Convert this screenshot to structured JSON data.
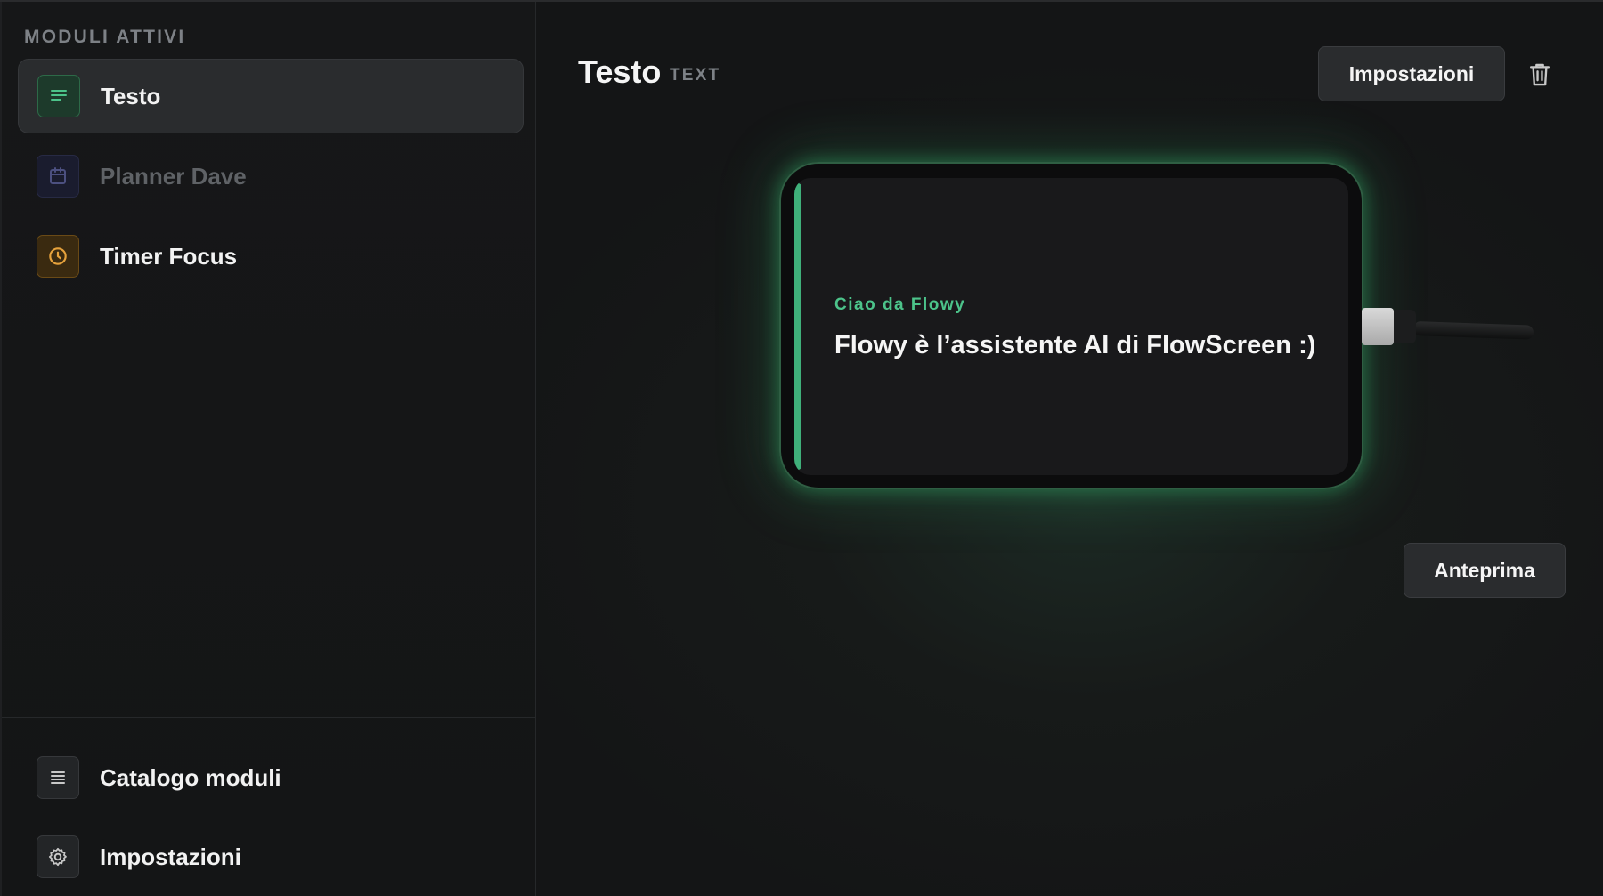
{
  "sidebar": {
    "section_title": "MODULI ATTIVI",
    "modules": [
      {
        "label": "Testo",
        "icon": "text-lines-icon",
        "active": true
      },
      {
        "label": "Planner Dave",
        "icon": "calendar-icon",
        "active": false,
        "dimmed": true
      },
      {
        "label": "Timer Focus",
        "icon": "clock-icon",
        "active": false
      }
    ],
    "footer": [
      {
        "label": "Catalogo moduli",
        "icon": "list-icon"
      },
      {
        "label": "Impostazioni",
        "icon": "gear-icon"
      }
    ]
  },
  "main": {
    "title": "Testo",
    "type_badge": "TEXT",
    "settings_button": "Impostazioni",
    "delete_icon": "trash-icon",
    "preview_button": "Anteprima",
    "device": {
      "kicker": "Ciao da Flowy",
      "message": "Flowy è l’assistente AI di FlowScreen :)"
    }
  },
  "colors": {
    "accent_green": "#3fb07a",
    "amber": "#e6a23c",
    "indigo": "#4c5080",
    "background": "#141516"
  }
}
